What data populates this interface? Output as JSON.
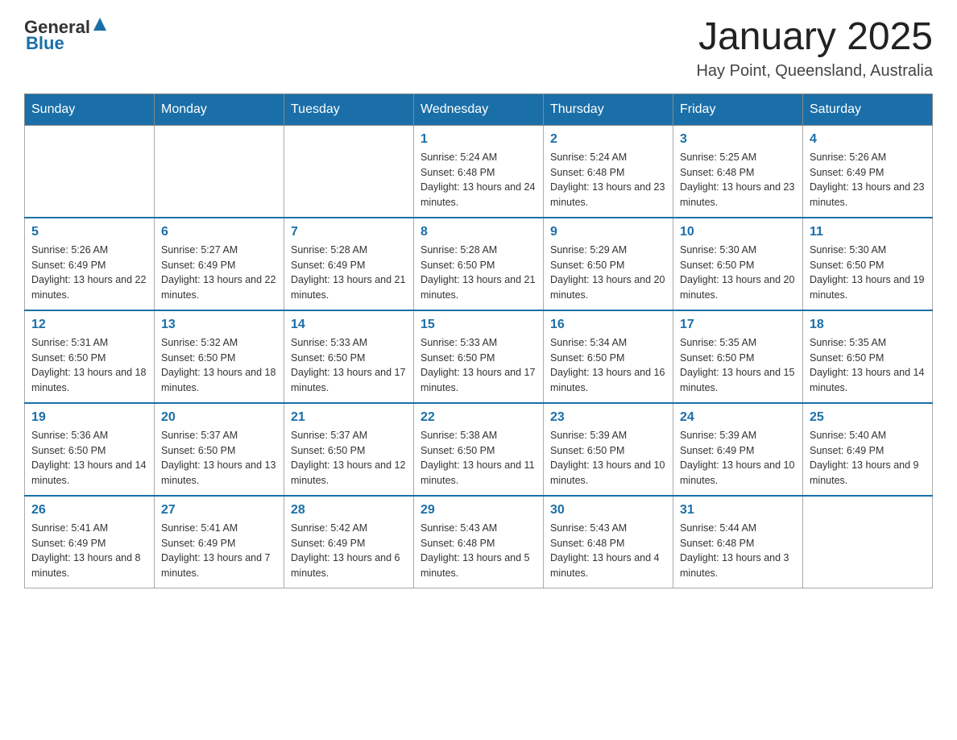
{
  "header": {
    "logo": {
      "general": "General",
      "blue": "Blue"
    },
    "title": "January 2025",
    "subtitle": "Hay Point, Queensland, Australia"
  },
  "weekdays": [
    "Sunday",
    "Monday",
    "Tuesday",
    "Wednesday",
    "Thursday",
    "Friday",
    "Saturday"
  ],
  "weeks": [
    [
      null,
      null,
      null,
      {
        "day": 1,
        "sunrise": "5:24 AM",
        "sunset": "6:48 PM",
        "daylight": "13 hours and 24 minutes."
      },
      {
        "day": 2,
        "sunrise": "5:24 AM",
        "sunset": "6:48 PM",
        "daylight": "13 hours and 23 minutes."
      },
      {
        "day": 3,
        "sunrise": "5:25 AM",
        "sunset": "6:48 PM",
        "daylight": "13 hours and 23 minutes."
      },
      {
        "day": 4,
        "sunrise": "5:26 AM",
        "sunset": "6:49 PM",
        "daylight": "13 hours and 23 minutes."
      }
    ],
    [
      {
        "day": 5,
        "sunrise": "5:26 AM",
        "sunset": "6:49 PM",
        "daylight": "13 hours and 22 minutes."
      },
      {
        "day": 6,
        "sunrise": "5:27 AM",
        "sunset": "6:49 PM",
        "daylight": "13 hours and 22 minutes."
      },
      {
        "day": 7,
        "sunrise": "5:28 AM",
        "sunset": "6:49 PM",
        "daylight": "13 hours and 21 minutes."
      },
      {
        "day": 8,
        "sunrise": "5:28 AM",
        "sunset": "6:50 PM",
        "daylight": "13 hours and 21 minutes."
      },
      {
        "day": 9,
        "sunrise": "5:29 AM",
        "sunset": "6:50 PM",
        "daylight": "13 hours and 20 minutes."
      },
      {
        "day": 10,
        "sunrise": "5:30 AM",
        "sunset": "6:50 PM",
        "daylight": "13 hours and 20 minutes."
      },
      {
        "day": 11,
        "sunrise": "5:30 AM",
        "sunset": "6:50 PM",
        "daylight": "13 hours and 19 minutes."
      }
    ],
    [
      {
        "day": 12,
        "sunrise": "5:31 AM",
        "sunset": "6:50 PM",
        "daylight": "13 hours and 18 minutes."
      },
      {
        "day": 13,
        "sunrise": "5:32 AM",
        "sunset": "6:50 PM",
        "daylight": "13 hours and 18 minutes."
      },
      {
        "day": 14,
        "sunrise": "5:33 AM",
        "sunset": "6:50 PM",
        "daylight": "13 hours and 17 minutes."
      },
      {
        "day": 15,
        "sunrise": "5:33 AM",
        "sunset": "6:50 PM",
        "daylight": "13 hours and 17 minutes."
      },
      {
        "day": 16,
        "sunrise": "5:34 AM",
        "sunset": "6:50 PM",
        "daylight": "13 hours and 16 minutes."
      },
      {
        "day": 17,
        "sunrise": "5:35 AM",
        "sunset": "6:50 PM",
        "daylight": "13 hours and 15 minutes."
      },
      {
        "day": 18,
        "sunrise": "5:35 AM",
        "sunset": "6:50 PM",
        "daylight": "13 hours and 14 minutes."
      }
    ],
    [
      {
        "day": 19,
        "sunrise": "5:36 AM",
        "sunset": "6:50 PM",
        "daylight": "13 hours and 14 minutes."
      },
      {
        "day": 20,
        "sunrise": "5:37 AM",
        "sunset": "6:50 PM",
        "daylight": "13 hours and 13 minutes."
      },
      {
        "day": 21,
        "sunrise": "5:37 AM",
        "sunset": "6:50 PM",
        "daylight": "13 hours and 12 minutes."
      },
      {
        "day": 22,
        "sunrise": "5:38 AM",
        "sunset": "6:50 PM",
        "daylight": "13 hours and 11 minutes."
      },
      {
        "day": 23,
        "sunrise": "5:39 AM",
        "sunset": "6:50 PM",
        "daylight": "13 hours and 10 minutes."
      },
      {
        "day": 24,
        "sunrise": "5:39 AM",
        "sunset": "6:49 PM",
        "daylight": "13 hours and 10 minutes."
      },
      {
        "day": 25,
        "sunrise": "5:40 AM",
        "sunset": "6:49 PM",
        "daylight": "13 hours and 9 minutes."
      }
    ],
    [
      {
        "day": 26,
        "sunrise": "5:41 AM",
        "sunset": "6:49 PM",
        "daylight": "13 hours and 8 minutes."
      },
      {
        "day": 27,
        "sunrise": "5:41 AM",
        "sunset": "6:49 PM",
        "daylight": "13 hours and 7 minutes."
      },
      {
        "day": 28,
        "sunrise": "5:42 AM",
        "sunset": "6:49 PM",
        "daylight": "13 hours and 6 minutes."
      },
      {
        "day": 29,
        "sunrise": "5:43 AM",
        "sunset": "6:48 PM",
        "daylight": "13 hours and 5 minutes."
      },
      {
        "day": 30,
        "sunrise": "5:43 AM",
        "sunset": "6:48 PM",
        "daylight": "13 hours and 4 minutes."
      },
      {
        "day": 31,
        "sunrise": "5:44 AM",
        "sunset": "6:48 PM",
        "daylight": "13 hours and 3 minutes."
      },
      null
    ]
  ]
}
